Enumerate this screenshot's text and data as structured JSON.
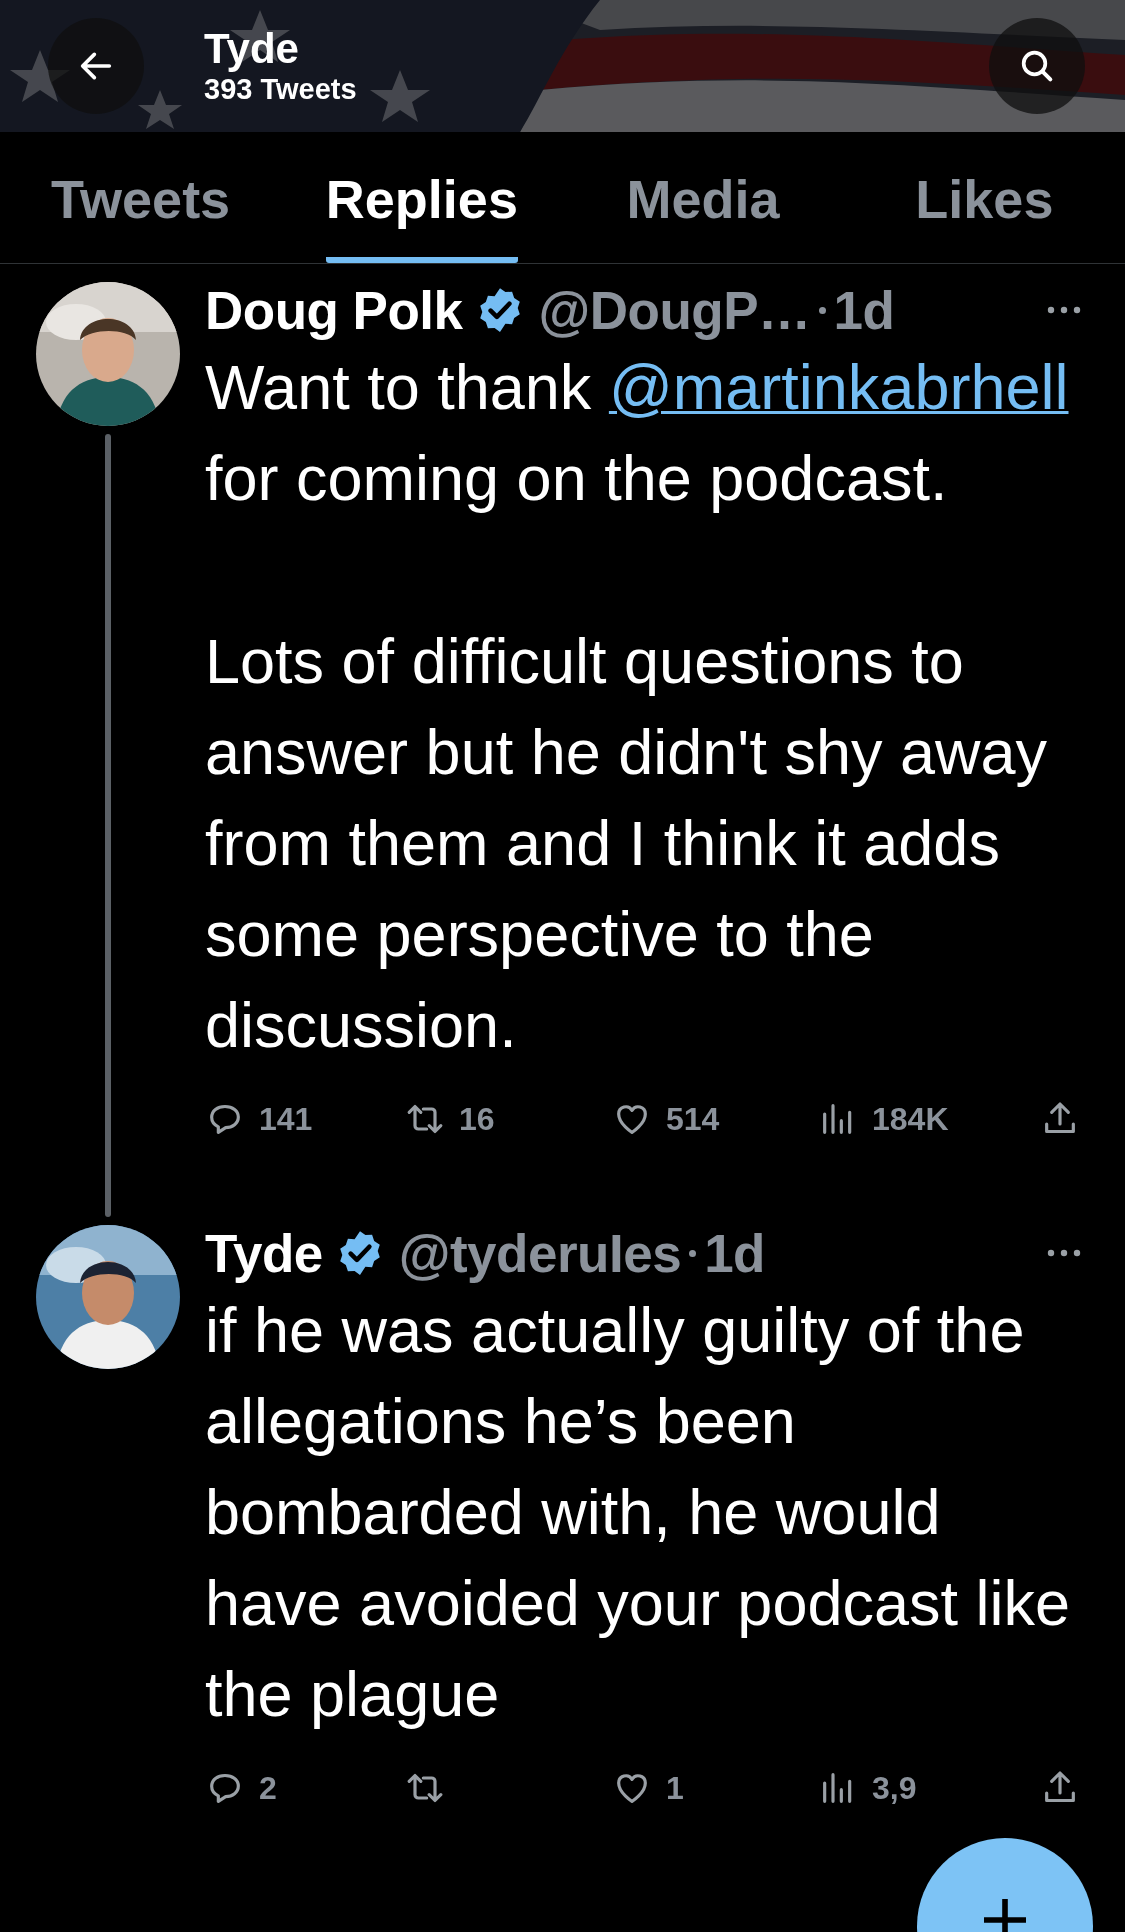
{
  "header": {
    "title": "Tyde",
    "subtitle": "393 Tweets"
  },
  "tabs": [
    {
      "label": "Tweets",
      "selected": false
    },
    {
      "label": "Replies",
      "selected": true
    },
    {
      "label": "Media",
      "selected": false
    },
    {
      "label": "Likes",
      "selected": false
    }
  ],
  "tweets": [
    {
      "name": "Doug Polk",
      "verified": true,
      "handle": "@DougP…",
      "time": "1d",
      "thread_line": true,
      "paragraphs": [
        [
          {
            "kind": "text",
            "text": "Want to thank "
          },
          {
            "kind": "mention",
            "text": "@martinkabrhell"
          },
          {
            "kind": "text",
            "text": " for coming on the podcast."
          }
        ],
        [
          {
            "kind": "text",
            "text": "Lots of difficult questions to answer but he didn't shy away from them and I think it adds some perspective to the discussion."
          }
        ]
      ],
      "actions": [
        {
          "kind": "reply",
          "count": "141"
        },
        {
          "kind": "retweet",
          "count": "16"
        },
        {
          "kind": "like",
          "count": "514"
        },
        {
          "kind": "views",
          "count": "184K"
        },
        {
          "kind": "share"
        }
      ]
    },
    {
      "name": "Tyde",
      "verified": true,
      "handle": "@tyderuIes",
      "time": "1d",
      "thread_line": false,
      "paragraphs": [
        [
          {
            "kind": "text",
            "text": "if he was actually guilty of the allegations he’s been bombarded with, he would have avoided your podcast like the plague"
          }
        ]
      ],
      "actions": [
        {
          "kind": "reply",
          "count": "2"
        },
        {
          "kind": "retweet"
        },
        {
          "kind": "like",
          "count": "1"
        },
        {
          "kind": "views",
          "count": "3,9"
        },
        {
          "kind": "share"
        }
      ]
    }
  ]
}
